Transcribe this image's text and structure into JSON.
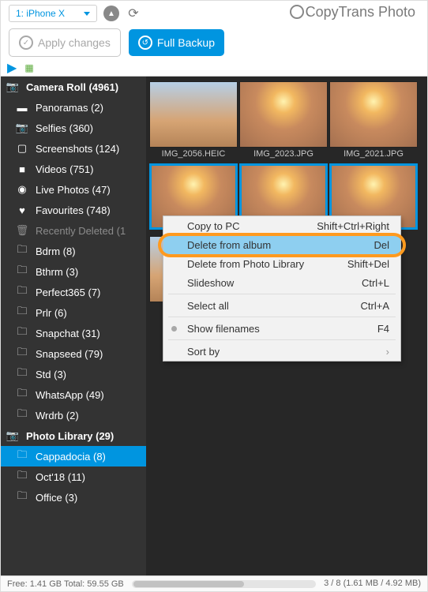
{
  "topbar": {
    "device": "1: iPhone X",
    "logo": "CopyTrans Photo"
  },
  "actions": {
    "apply": "Apply changes",
    "backup": "Full Backup"
  },
  "sidebar": {
    "cameraRoll": "Camera Roll (4961)",
    "items": [
      {
        "icon": "▬",
        "label": "Panoramas (2)"
      },
      {
        "icon": "📷",
        "label": "Selfies (360)"
      },
      {
        "icon": "▢",
        "label": "Screenshots (124)"
      },
      {
        "icon": "■",
        "label": "Videos (751)"
      },
      {
        "icon": "◉",
        "label": "Live Photos (47)"
      },
      {
        "icon": "♥",
        "label": "Favourites (748)"
      },
      {
        "icon": "🗑",
        "label": "Recently Deleted (1",
        "dim": true
      },
      {
        "icon": "🗀",
        "label": "Bdrm (8)"
      },
      {
        "icon": "🗀",
        "label": "Bthrm (3)"
      },
      {
        "icon": "🗀",
        "label": "Perfect365 (7)"
      },
      {
        "icon": "🗀",
        "label": "Prlr (6)"
      },
      {
        "icon": "🗀",
        "label": "Snapchat (31)"
      },
      {
        "icon": "🗀",
        "label": "Snapseed (79)"
      },
      {
        "icon": "🗀",
        "label": "Std (3)"
      },
      {
        "icon": "🗀",
        "label": "WhatsApp (49)"
      },
      {
        "icon": "🗀",
        "label": "Wrdrb (2)"
      }
    ],
    "photoLib": "Photo Library (29)",
    "libItems": [
      {
        "label": "Cappadocia (8)",
        "sel": true
      },
      {
        "label": "Oct'18 (11)"
      },
      {
        "label": "Office (3)"
      }
    ]
  },
  "thumbs": [
    {
      "name": "IMG_2056.HEIC",
      "sun": false,
      "sel": false
    },
    {
      "name": "IMG_2023.JPG",
      "sun": true,
      "sel": false
    },
    {
      "name": "IMG_2021.JPG",
      "sun": true,
      "sel": false
    },
    {
      "name": "",
      "sun": true,
      "sel": true
    },
    {
      "name": "",
      "sun": true,
      "sel": true
    },
    {
      "name": "",
      "sun": true,
      "sel": true
    },
    {
      "name": "",
      "sun": false,
      "sel": false
    }
  ],
  "ctx": [
    {
      "label": "Copy to PC",
      "short": "Shift+Ctrl+Right"
    },
    {
      "label": "Delete from album",
      "short": "Del",
      "hl": true
    },
    {
      "label": "Delete from Photo Library",
      "short": "Shift+Del"
    },
    {
      "label": "Slideshow",
      "short": "Ctrl+L",
      "sepAfter": true
    },
    {
      "label": "Select all",
      "short": "Ctrl+A",
      "sepAfter": true
    },
    {
      "label": "Show filenames",
      "short": "F4",
      "dot": true,
      "sepAfter": true
    },
    {
      "label": "Sort by",
      "short": "›",
      "arrow": true
    }
  ],
  "status": {
    "left": "Free: 1.41 GB Total: 59.55 GB",
    "right": "3 / 8 (1.61 MB / 4.92 MB)"
  }
}
